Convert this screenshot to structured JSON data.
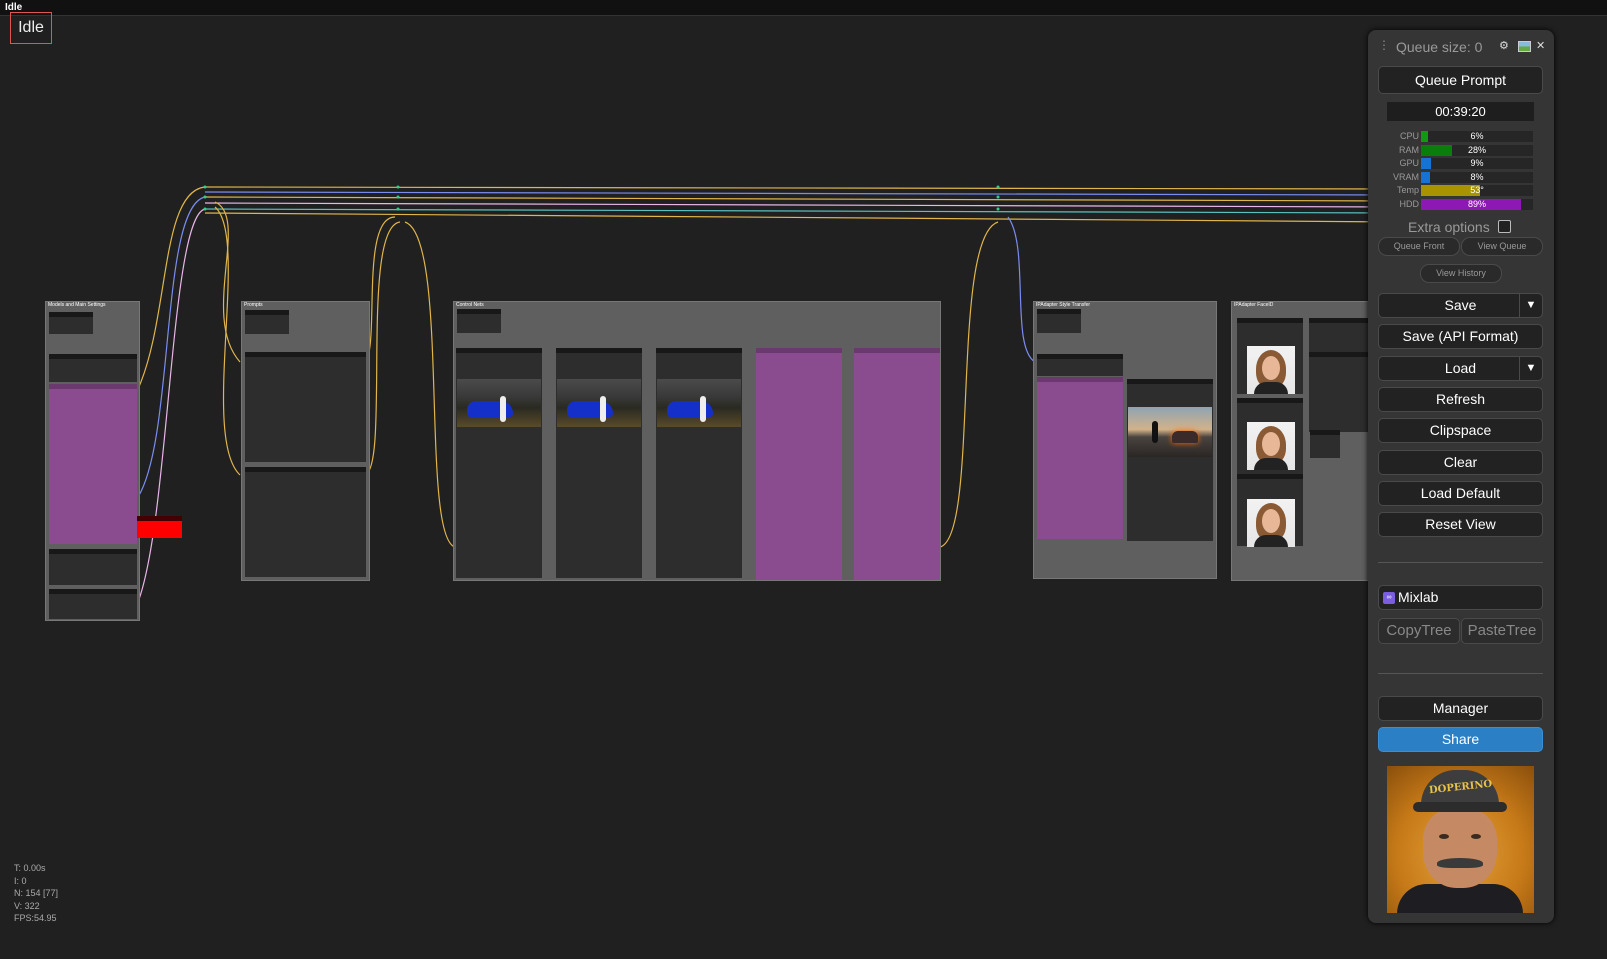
{
  "window": {
    "title": "Idle"
  },
  "status_badge": "Idle",
  "groups": [
    {
      "title": "Models and Main Settings"
    },
    {
      "title": "Prompts"
    },
    {
      "title": "Control Nets"
    },
    {
      "title": "IPAdapter Style Transfer"
    },
    {
      "title": "IPAdapter FaceID"
    }
  ],
  "canvas_stats": {
    "t": "T: 0.00s",
    "i": "I: 0",
    "n": "N: 154 [77]",
    "v": "V: 322",
    "fps": "FPS:54.95"
  },
  "panel": {
    "queue_size": "Queue size: 0",
    "icons": [
      "drag-handle-icon",
      "gear-icon",
      "image-icon",
      "close-icon"
    ],
    "queue_prompt": "Queue Prompt",
    "timer": "00:39:20",
    "monitor": [
      {
        "label": "CPU",
        "value": "6%",
        "level": 0.06,
        "color": "#0f9a0f"
      },
      {
        "label": "RAM",
        "value": "28%",
        "level": 0.28,
        "color": "#0a7d0a"
      },
      {
        "label": "GPU",
        "value": "9%",
        "level": 0.09,
        "color": "#1673d6"
      },
      {
        "label": "VRAM",
        "value": "8%",
        "level": 0.08,
        "color": "#1673d6"
      },
      {
        "label": "Temp",
        "value": "53°",
        "level": 0.53,
        "color": "#a89300"
      },
      {
        "label": "HDD",
        "value": "89%",
        "level": 0.89,
        "color": "#8e18b3"
      }
    ],
    "extra_options": "Extra options",
    "queue_front": "Queue Front",
    "view_queue": "View Queue",
    "view_history": "View History",
    "save": "Save",
    "save_api": "Save (API Format)",
    "load": "Load",
    "refresh": "Refresh",
    "clipspace": "Clipspace",
    "clear": "Clear",
    "load_default": "Load Default",
    "reset_view": "Reset View",
    "mixlab": "Mixlab",
    "copy_tree": "CopyTree",
    "paste_tree": "PasteTree",
    "manager": "Manager",
    "share": "Share",
    "portrait_cap_text": "DOPERINO"
  },
  "colors": {
    "canvas_bg": "#202020",
    "group_bg": "#5f5f5f",
    "node_purple": "#8a4c8e",
    "share_blue": "#2b7fc4"
  }
}
